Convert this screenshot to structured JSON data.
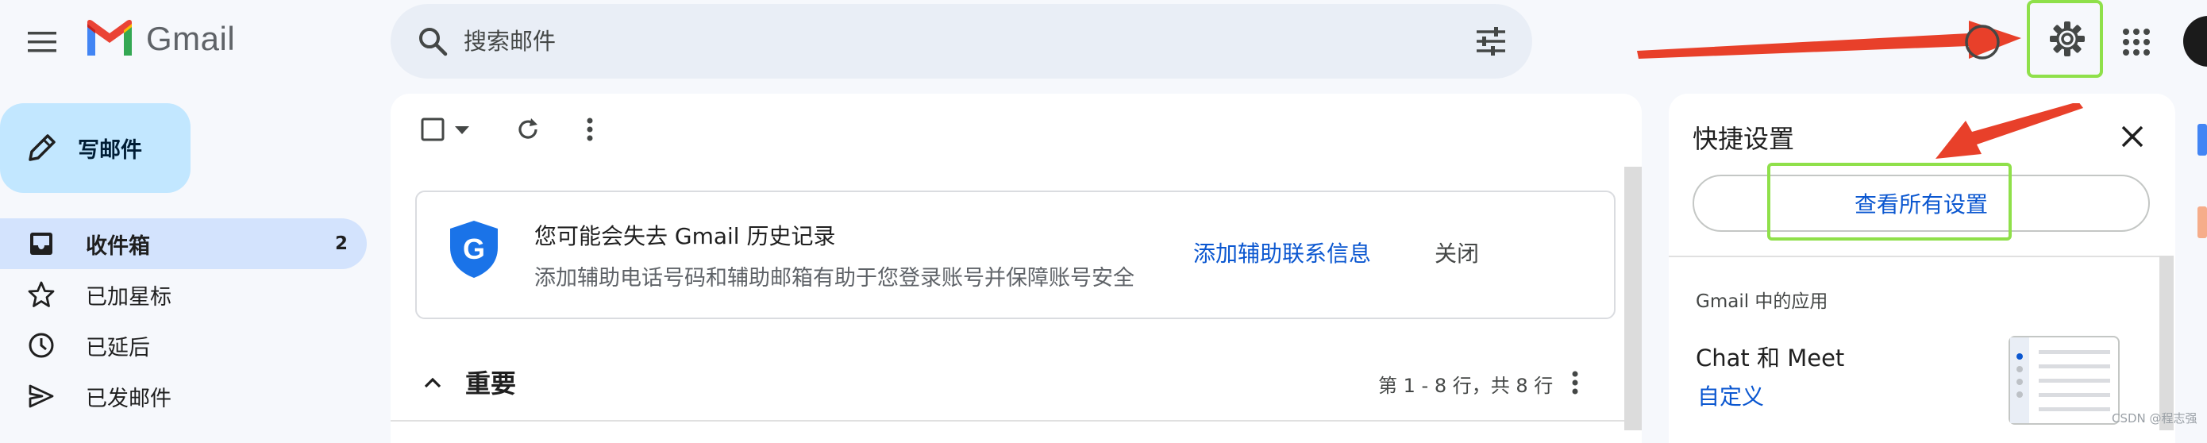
{
  "app": {
    "name": "Gmail",
    "accent": "#0b57d0",
    "highlight_color": "#8fe04a",
    "arrow_color": "#e8402a"
  },
  "header": {
    "search_placeholder": "搜索邮件",
    "icons": [
      "menu-icon",
      "gmail-logo",
      "search-icon",
      "filter-icon",
      "help-icon",
      "settings-gear-icon",
      "apps-grid-icon",
      "avatar"
    ]
  },
  "compose": {
    "label": "写邮件"
  },
  "sidebar": {
    "items": [
      {
        "label": "收件箱",
        "count": "2",
        "icon": "inbox-icon",
        "active": true
      },
      {
        "label": "已加星标",
        "icon": "star-icon"
      },
      {
        "label": "已延后",
        "icon": "clock-icon"
      },
      {
        "label": "已发邮件",
        "icon": "send-icon"
      }
    ]
  },
  "notice": {
    "title": "您可能会失去 Gmail 历史记录",
    "description": "添加辅助电话号码和辅助邮箱有助于您登录账号并保障账号安全",
    "action": "添加辅助联系信息",
    "close": "关闭"
  },
  "section": {
    "title": "重要",
    "page_info": "第 1 - 8 行，共 8 行"
  },
  "quick_settings": {
    "title": "快捷设置",
    "see_all": "查看所有设置",
    "apps_section": "Gmail 中的应用",
    "app_name": "Chat 和 Meet",
    "customize": "自定义"
  },
  "watermark": "CSDN @程志强"
}
